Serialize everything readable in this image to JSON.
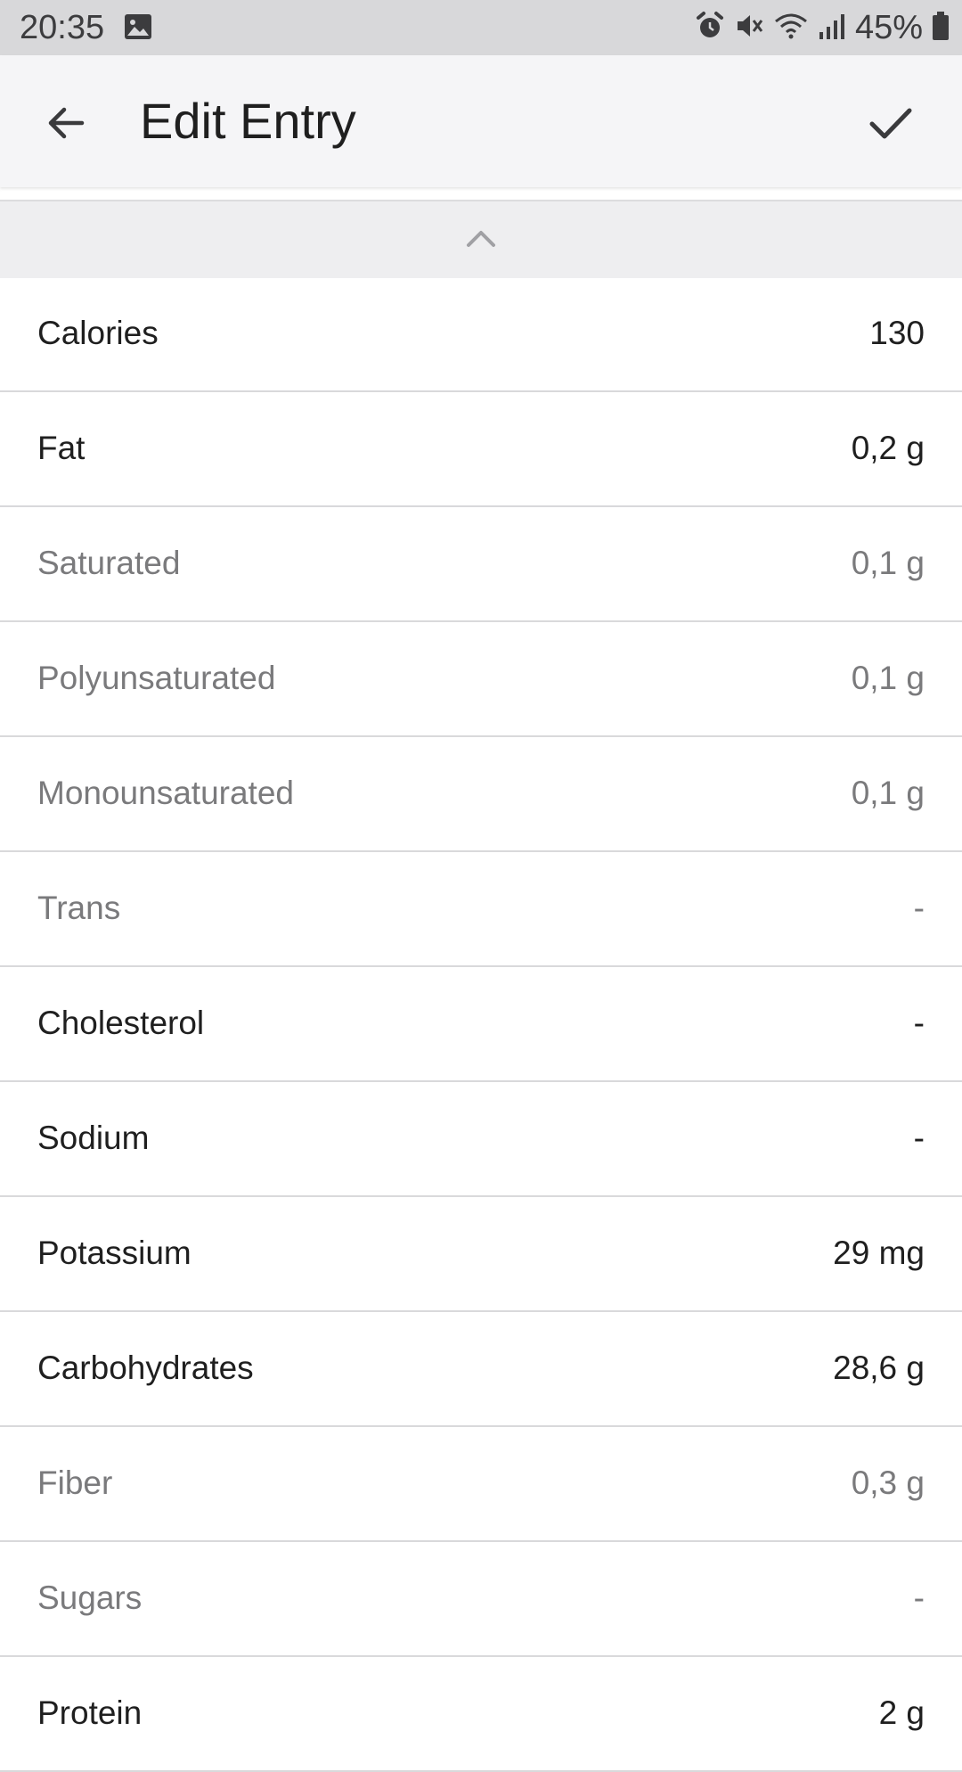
{
  "status_bar": {
    "time": "20:35",
    "battery": "45%",
    "icons": [
      "image-icon",
      "alarm-icon",
      "mute-icon",
      "wifi-icon",
      "signal-icon",
      "battery-icon"
    ]
  },
  "app_bar": {
    "title": "Edit Entry",
    "back_icon": "arrow-left-icon",
    "confirm_icon": "check-icon"
  },
  "collapse_icon": "chevron-up-icon",
  "nutrients": [
    {
      "label": "Calories",
      "value": "130",
      "style": "primary"
    },
    {
      "label": "Fat",
      "value": "0,2 g",
      "style": "primary"
    },
    {
      "label": "Saturated",
      "value": "0,1 g",
      "style": "secondary"
    },
    {
      "label": "Polyunsaturated",
      "value": "0,1 g",
      "style": "secondary"
    },
    {
      "label": "Monounsaturated",
      "value": "0,1 g",
      "style": "secondary"
    },
    {
      "label": "Trans",
      "value": "-",
      "style": "secondary"
    },
    {
      "label": "Cholesterol",
      "value": "-",
      "style": "primary"
    },
    {
      "label": "Sodium",
      "value": "-",
      "style": "primary"
    },
    {
      "label": "Potassium",
      "value": "29 mg",
      "style": "primary"
    },
    {
      "label": "Carbohydrates",
      "value": "28,6 g",
      "style": "primary"
    },
    {
      "label": "Fiber",
      "value": "0,3 g",
      "style": "secondary"
    },
    {
      "label": "Sugars",
      "value": "-",
      "style": "secondary"
    },
    {
      "label": "Protein",
      "value": "2 g",
      "style": "primary"
    }
  ],
  "colors": {
    "primary_text": "#1f1f1f",
    "secondary_text": "#7a7a7c",
    "status_bar": "#d8d8da",
    "app_bar": "#f5f5f7",
    "divider": "#d9d9db"
  }
}
